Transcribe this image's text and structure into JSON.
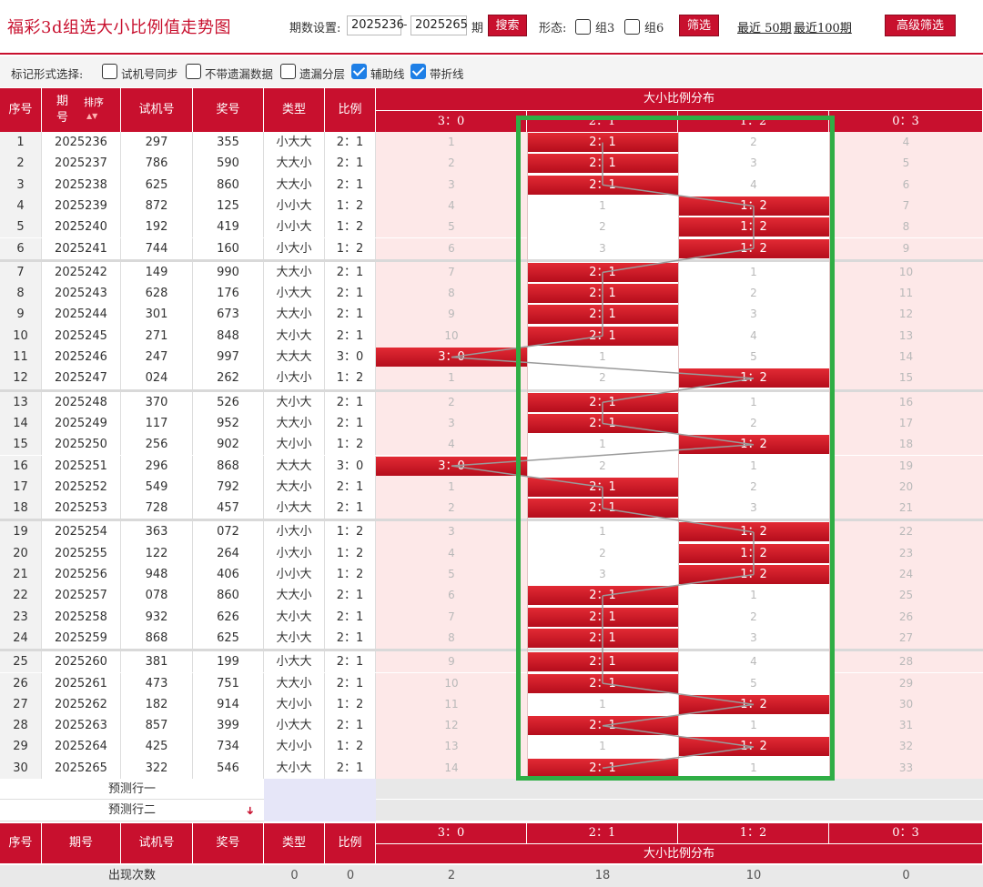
{
  "title": "福彩3d组选大小比例值走势图",
  "controls": {
    "period_label": "期数设置:",
    "from": "2025236",
    "dash": "-",
    "to": "2025265",
    "period_suffix": "期",
    "search_label": "搜索",
    "shape_label": "形态:",
    "group3_label": "组3",
    "group6_label": "组6",
    "filter_label": "筛选",
    "recent50_label": "最近 50期",
    "recent100_label": "最近100期",
    "advanced_label": "高级筛选"
  },
  "markbar": {
    "label": "标记形式选择:",
    "options": [
      {
        "label": "试机号同步",
        "checked": false
      },
      {
        "label": "不带遗漏数据",
        "checked": false
      },
      {
        "label": "遗漏分层",
        "checked": false
      },
      {
        "label": "辅助线",
        "checked": true
      },
      {
        "label": "带折线",
        "checked": true
      }
    ]
  },
  "header": {
    "idx": "序号",
    "period_top": "期",
    "period_bottom": "号",
    "sort": "排序",
    "trial": "试机号",
    "draw": "奖号",
    "type": "类型",
    "ratio": "比例",
    "dist_title": "大小比例分布",
    "dist_cols": [
      "3：0",
      "2：1",
      "1：2",
      "0：3"
    ]
  },
  "rows": [
    {
      "idx": "1",
      "period": "2025236",
      "trial": "297",
      "draw": "355",
      "type": "小大大",
      "ratio": "2：1",
      "dist": [
        "1",
        "2：1",
        "2",
        "4"
      ],
      "hit": 1
    },
    {
      "idx": "2",
      "period": "2025237",
      "trial": "786",
      "draw": "590",
      "type": "大大小",
      "ratio": "2：1",
      "dist": [
        "2",
        "2：1",
        "3",
        "5"
      ],
      "hit": 1
    },
    {
      "idx": "3",
      "period": "2025238",
      "trial": "625",
      "draw": "860",
      "type": "大大小",
      "ratio": "2：1",
      "dist": [
        "3",
        "2：1",
        "4",
        "6"
      ],
      "hit": 1
    },
    {
      "idx": "4",
      "period": "2025239",
      "trial": "872",
      "draw": "125",
      "type": "小小大",
      "ratio": "1：2",
      "dist": [
        "4",
        "1",
        "1：2",
        "7"
      ],
      "hit": 2
    },
    {
      "idx": "5",
      "period": "2025240",
      "trial": "192",
      "draw": "419",
      "type": "小小大",
      "ratio": "1：2",
      "dist": [
        "5",
        "2",
        "1：2",
        "8"
      ],
      "hit": 2
    },
    {
      "idx": "6",
      "period": "2025241",
      "trial": "744",
      "draw": "160",
      "type": "小大小",
      "ratio": "1：2",
      "dist": [
        "6",
        "3",
        "1：2",
        "9"
      ],
      "hit": 2
    },
    {
      "idx": "7",
      "period": "2025242",
      "trial": "149",
      "draw": "990",
      "type": "大大小",
      "ratio": "2：1",
      "dist": [
        "7",
        "2：1",
        "1",
        "10"
      ],
      "hit": 1
    },
    {
      "idx": "8",
      "period": "2025243",
      "trial": "628",
      "draw": "176",
      "type": "小大大",
      "ratio": "2：1",
      "dist": [
        "8",
        "2：1",
        "2",
        "11"
      ],
      "hit": 1
    },
    {
      "idx": "9",
      "period": "2025244",
      "trial": "301",
      "draw": "673",
      "type": "大大小",
      "ratio": "2：1",
      "dist": [
        "9",
        "2：1",
        "3",
        "12"
      ],
      "hit": 1
    },
    {
      "idx": "10",
      "period": "2025245",
      "trial": "271",
      "draw": "848",
      "type": "大小大",
      "ratio": "2：1",
      "dist": [
        "10",
        "2：1",
        "4",
        "13"
      ],
      "hit": 1
    },
    {
      "idx": "11",
      "period": "2025246",
      "trial": "247",
      "draw": "997",
      "type": "大大大",
      "ratio": "3：0",
      "dist": [
        "3：0",
        "1",
        "5",
        "14"
      ],
      "hit": 0
    },
    {
      "idx": "12",
      "period": "2025247",
      "trial": "024",
      "draw": "262",
      "type": "小大小",
      "ratio": "1：2",
      "dist": [
        "1",
        "2",
        "1：2",
        "15"
      ],
      "hit": 2
    },
    {
      "idx": "13",
      "period": "2025248",
      "trial": "370",
      "draw": "526",
      "type": "大小大",
      "ratio": "2：1",
      "dist": [
        "2",
        "2：1",
        "1",
        "16"
      ],
      "hit": 1
    },
    {
      "idx": "14",
      "period": "2025249",
      "trial": "117",
      "draw": "952",
      "type": "大大小",
      "ratio": "2：1",
      "dist": [
        "3",
        "2：1",
        "2",
        "17"
      ],
      "hit": 1
    },
    {
      "idx": "15",
      "period": "2025250",
      "trial": "256",
      "draw": "902",
      "type": "大小小",
      "ratio": "1：2",
      "dist": [
        "4",
        "1",
        "1：2",
        "18"
      ],
      "hit": 2
    },
    {
      "idx": "16",
      "period": "2025251",
      "trial": "296",
      "draw": "868",
      "type": "大大大",
      "ratio": "3：0",
      "dist": [
        "3：0",
        "2",
        "1",
        "19"
      ],
      "hit": 0
    },
    {
      "idx": "17",
      "period": "2025252",
      "trial": "549",
      "draw": "792",
      "type": "大大小",
      "ratio": "2：1",
      "dist": [
        "1",
        "2：1",
        "2",
        "20"
      ],
      "hit": 1
    },
    {
      "idx": "18",
      "period": "2025253",
      "trial": "728",
      "draw": "457",
      "type": "小大大",
      "ratio": "2：1",
      "dist": [
        "2",
        "2：1",
        "3",
        "21"
      ],
      "hit": 1
    },
    {
      "idx": "19",
      "period": "2025254",
      "trial": "363",
      "draw": "072",
      "type": "小大小",
      "ratio": "1：2",
      "dist": [
        "3",
        "1",
        "1：2",
        "22"
      ],
      "hit": 2
    },
    {
      "idx": "20",
      "period": "2025255",
      "trial": "122",
      "draw": "264",
      "type": "小大小",
      "ratio": "1：2",
      "dist": [
        "4",
        "2",
        "1：2",
        "23"
      ],
      "hit": 2
    },
    {
      "idx": "21",
      "period": "2025256",
      "trial": "948",
      "draw": "406",
      "type": "小小大",
      "ratio": "1：2",
      "dist": [
        "5",
        "3",
        "1：2",
        "24"
      ],
      "hit": 2
    },
    {
      "idx": "22",
      "period": "2025257",
      "trial": "078",
      "draw": "860",
      "type": "大大小",
      "ratio": "2：1",
      "dist": [
        "6",
        "2：1",
        "1",
        "25"
      ],
      "hit": 1
    },
    {
      "idx": "23",
      "period": "2025258",
      "trial": "932",
      "draw": "626",
      "type": "大小大",
      "ratio": "2：1",
      "dist": [
        "7",
        "2：1",
        "2",
        "26"
      ],
      "hit": 1
    },
    {
      "idx": "24",
      "period": "2025259",
      "trial": "868",
      "draw": "625",
      "type": "大小大",
      "ratio": "2：1",
      "dist": [
        "8",
        "2：1",
        "3",
        "27"
      ],
      "hit": 1
    },
    {
      "idx": "25",
      "period": "2025260",
      "trial": "381",
      "draw": "199",
      "type": "小大大",
      "ratio": "2：1",
      "dist": [
        "9",
        "2：1",
        "4",
        "28"
      ],
      "hit": 1
    },
    {
      "idx": "26",
      "period": "2025261",
      "trial": "473",
      "draw": "751",
      "type": "大大小",
      "ratio": "2：1",
      "dist": [
        "10",
        "2：1",
        "5",
        "29"
      ],
      "hit": 1
    },
    {
      "idx": "27",
      "period": "2025262",
      "trial": "182",
      "draw": "914",
      "type": "大小小",
      "ratio": "1：2",
      "dist": [
        "11",
        "1",
        "1：2",
        "30"
      ],
      "hit": 2
    },
    {
      "idx": "28",
      "period": "2025263",
      "trial": "857",
      "draw": "399",
      "type": "小大大",
      "ratio": "2：1",
      "dist": [
        "12",
        "2：1",
        "1",
        "31"
      ],
      "hit": 1
    },
    {
      "idx": "29",
      "period": "2025264",
      "trial": "425",
      "draw": "734",
      "type": "大小小",
      "ratio": "1：2",
      "dist": [
        "13",
        "1",
        "1：2",
        "32"
      ],
      "hit": 2
    },
    {
      "idx": "30",
      "period": "2025265",
      "trial": "322",
      "draw": "546",
      "type": "大小大",
      "ratio": "2：1",
      "dist": [
        "14",
        "2：1",
        "1",
        "33"
      ],
      "hit": 1
    }
  ],
  "predict": {
    "row1": "预测行一",
    "row2": "预测行二"
  },
  "stats": {
    "label": "出现次数",
    "values": [
      "0",
      "0",
      "2",
      "18",
      "10",
      "0"
    ]
  },
  "colors": {
    "accent": "#c8102e",
    "highlight_box": "#2fae45",
    "check": "#1e7fe6"
  }
}
